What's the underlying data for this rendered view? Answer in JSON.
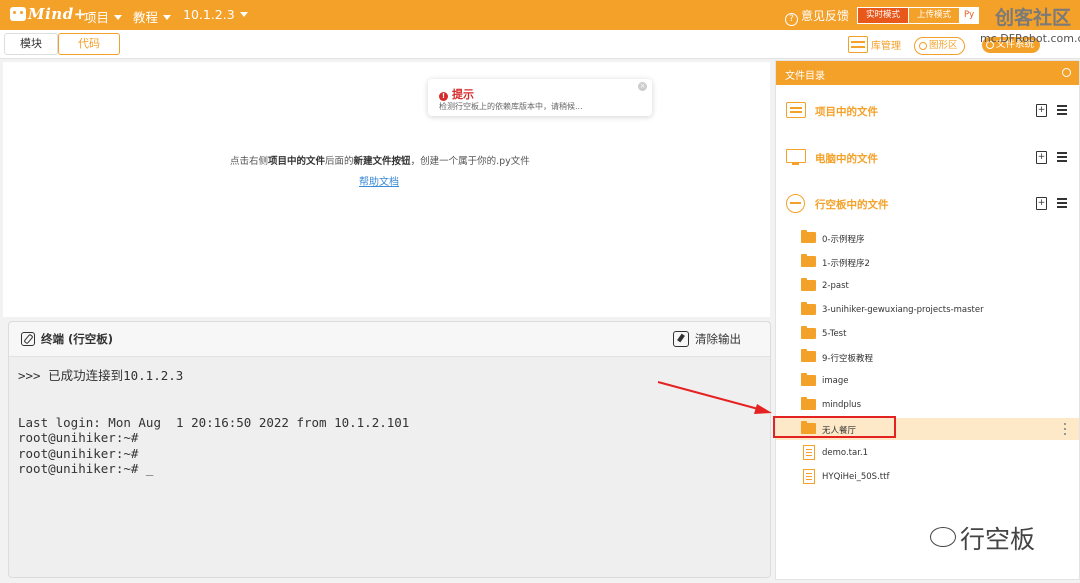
{
  "topbar": {
    "menus": [
      {
        "label": "项目"
      },
      {
        "label": "教程"
      },
      {
        "label": "10.1.2.3"
      }
    ],
    "feedback": "意见反馈",
    "modes": {
      "realtime": "实时模式",
      "upload": "上传模式",
      "python": "Py"
    }
  },
  "watermark": {
    "title": "创客社区",
    "url": "mc.DFRobot.com.cn",
    "bottom": "行空板"
  },
  "tabs": {
    "blocks": "模块",
    "code": "代码"
  },
  "toolbar": {
    "library": "库管理",
    "graphics": "图形区",
    "filesystem": "文件系统"
  },
  "hint": {
    "title": "提示",
    "message": "检测行空板上的依赖库版本中，请稍候..."
  },
  "editor": {
    "empty_pre": "点击右侧",
    "empty_bold1": "项目中的文件",
    "empty_mid": "后面的",
    "empty_bold2": "新建文件按钮",
    "empty_post": "，创建一个属于你的.py文件",
    "help_link": "帮助文档"
  },
  "terminal": {
    "title": "终端 (行空板)",
    "clear": "清除输出",
    "output": ">>> 已成功连接到10.1.2.3\n\n\nLast login: Mon Aug  1 20:16:50 2022 from 10.1.2.101\nroot@unihiker:~#\nroot@unihiker:~#\nroot@unihiker:~# _"
  },
  "file_panel": {
    "title": "文件目录",
    "sections": [
      {
        "label": "项目中的文件"
      },
      {
        "label": "电脑中的文件"
      },
      {
        "label": "行空板中的文件"
      }
    ],
    "items": [
      {
        "name": "0-示例程序",
        "type": "folder"
      },
      {
        "name": "1-示例程序2",
        "type": "folder"
      },
      {
        "name": "2-past",
        "type": "folder"
      },
      {
        "name": "3-unihiker-gewuxiang-projects-master",
        "type": "folder"
      },
      {
        "name": "5-Test",
        "type": "folder"
      },
      {
        "name": "9-行空板教程",
        "type": "folder"
      },
      {
        "name": "image",
        "type": "folder"
      },
      {
        "name": "mindplus",
        "type": "folder"
      },
      {
        "name": "无人餐厅",
        "type": "folder",
        "selected": true
      },
      {
        "name": "demo.tar.1",
        "type": "file"
      },
      {
        "name": "HYQiHei_50S.ttf",
        "type": "file"
      }
    ]
  },
  "colors": {
    "accent": "#f4a12a",
    "highlight": "#e52222",
    "selected_row": "#fde9c8"
  },
  "icons": [
    "mindplus-logo-icon",
    "question-icon",
    "library-icon",
    "graphics-icon",
    "filesystem-icon",
    "warning-icon",
    "close-icon",
    "link-icon",
    "clear-icon",
    "refresh-icon",
    "project-files-icon",
    "computer-icon",
    "board-icon",
    "new-file-icon",
    "menu-icon",
    "folder-icon",
    "file-icon",
    "kebab-icon",
    "wechat-icon"
  ]
}
